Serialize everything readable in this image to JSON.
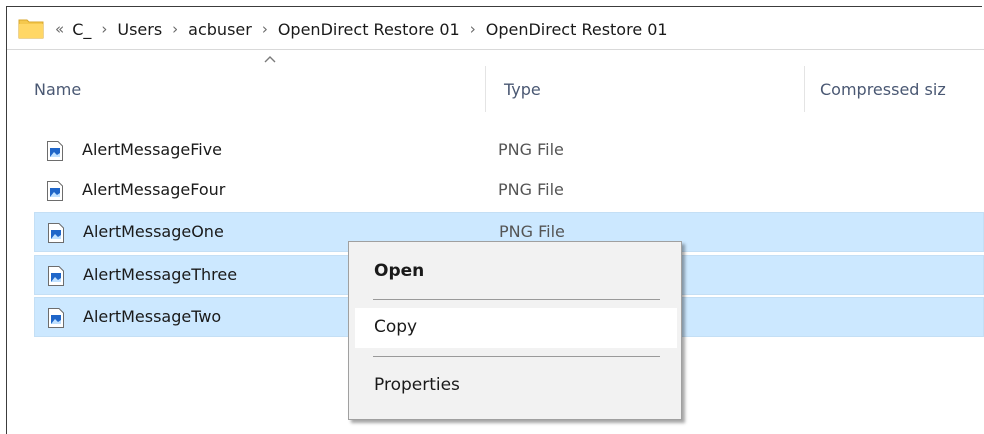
{
  "breadcrumb": {
    "overflow": "«",
    "items": [
      "C_",
      "Users",
      "acbuser",
      "OpenDirect Restore 01",
      "OpenDirect Restore 01"
    ]
  },
  "columns": {
    "name": "Name",
    "type": "Type",
    "compressed_size": "Compressed siz"
  },
  "files": [
    {
      "name": "AlertMessageFive",
      "type": "PNG File",
      "selected": false
    },
    {
      "name": "AlertMessageFour",
      "type": "PNG File",
      "selected": false
    },
    {
      "name": "AlertMessageOne",
      "type": "PNG File",
      "selected": true
    },
    {
      "name": "AlertMessageThree",
      "type": "",
      "selected": true
    },
    {
      "name": "AlertMessageTwo",
      "type": "",
      "selected": true
    }
  ],
  "context_menu": {
    "open": "Open",
    "copy": "Copy",
    "properties": "Properties"
  },
  "colors": {
    "selection": "#cce8ff",
    "menu_bg": "#f2f2f2",
    "folder": "#f2c35b"
  }
}
